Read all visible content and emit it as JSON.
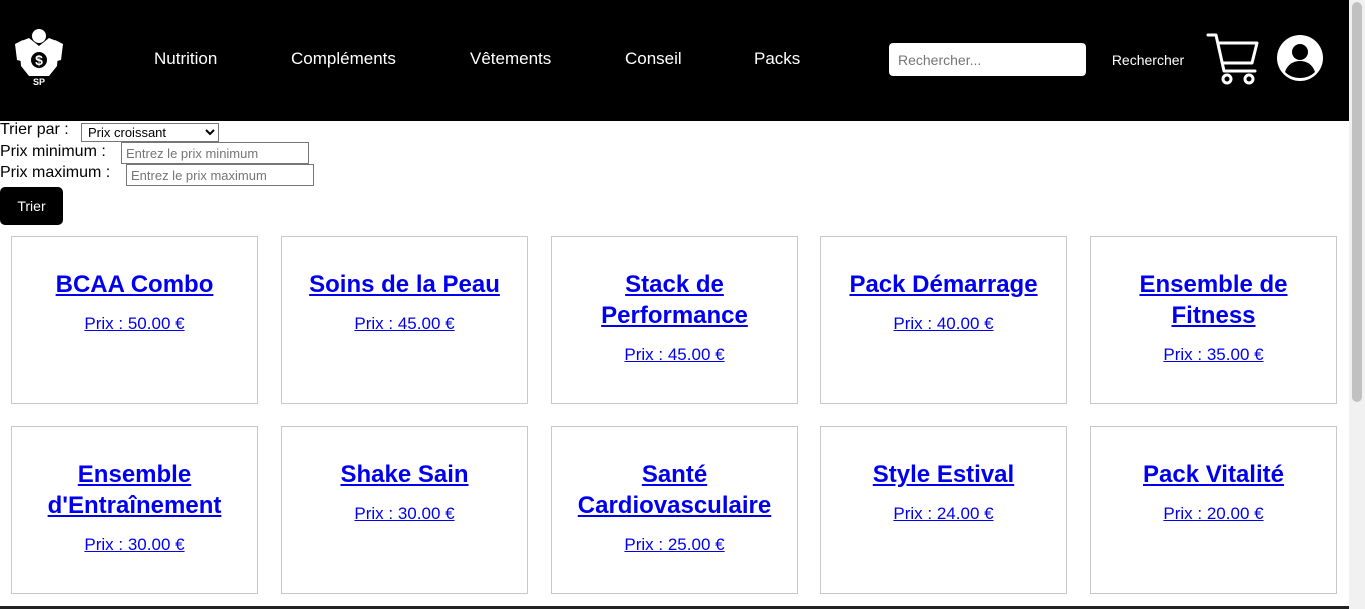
{
  "header": {
    "logo_text": "SP",
    "nav": [
      {
        "label": "Nutrition"
      },
      {
        "label": "Compléments"
      },
      {
        "label": "Vêtements"
      },
      {
        "label": "Conseil"
      },
      {
        "label": "Packs"
      }
    ],
    "search": {
      "placeholder": "Rechercher...",
      "value": "",
      "button_label": "Rechercher"
    },
    "icons": {
      "cart": "shopping-cart-icon",
      "user": "user-account-icon"
    }
  },
  "filters": {
    "sort_label": "Trier par :",
    "sort_selected": "Prix croissant",
    "min_label": "Prix minimum :",
    "min_placeholder": "Entrez le prix minimum",
    "max_label": "Prix maximum :",
    "max_placeholder": "Entrez le prix maximum",
    "button_label": "Trier"
  },
  "products": [
    {
      "name": "BCAA Combo",
      "price": "Prix : 50.00 €"
    },
    {
      "name": "Soins de la Peau",
      "price": "Prix : 45.00 €"
    },
    {
      "name": "Stack de Performance",
      "price": "Prix : 45.00 €"
    },
    {
      "name": "Pack Démarrage",
      "price": "Prix : 40.00 €"
    },
    {
      "name": "Ensemble de Fitness",
      "price": "Prix : 35.00 €"
    },
    {
      "name": "Ensemble d'Entraînement",
      "price": "Prix : 30.00 €"
    },
    {
      "name": "Shake Sain",
      "price": "Prix : 30.00 €"
    },
    {
      "name": "Santé Cardiovasculaire",
      "price": "Prix : 25.00 €"
    },
    {
      "name": "Style Estival",
      "price": "Prix : 24.00 €"
    },
    {
      "name": "Pack Vitalité",
      "price": "Prix : 20.00 €"
    }
  ],
  "colors": {
    "header_bg": "#000000",
    "link": "#0000ee",
    "button_bg": "#000000"
  }
}
